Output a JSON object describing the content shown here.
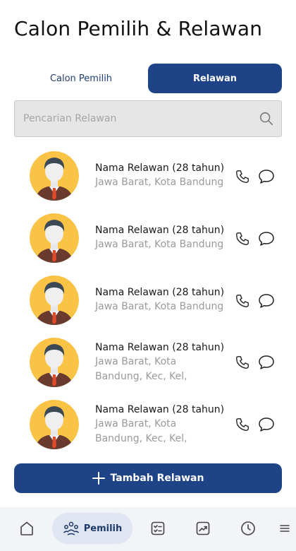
{
  "page": {
    "title": "Calon Pemilih & Relawan"
  },
  "tabs": [
    {
      "label": "Calon Pemilih",
      "active": false
    },
    {
      "label": "Relawan",
      "active": true
    }
  ],
  "search": {
    "placeholder": "Pencarian Relawan",
    "value": ""
  },
  "volunteers": [
    {
      "name": "Nama Relawan (28 tahun)",
      "location": "Jawa Barat, Kota Bandung"
    },
    {
      "name": "Nama Relawan (28 tahun)",
      "location": "Jawa Barat, Kota Bandung"
    },
    {
      "name": "Nama Relawan (28 tahun)",
      "location": "Jawa Barat, Kota Bandung"
    },
    {
      "name": "Nama Relawan (28 tahun)",
      "location": "Jawa Barat, Kota Bandung, Kec, Kel,"
    },
    {
      "name": "Nama Relawan (28 tahun)",
      "location": "Jawa Barat, Kota Bandung, Kec, Kel,"
    }
  ],
  "add_button": {
    "label": "Tambah Relawan"
  },
  "bottom_nav": [
    {
      "icon": "home-icon",
      "label": ""
    },
    {
      "icon": "people-icon",
      "label": "Pemilih",
      "active": true
    },
    {
      "icon": "checklist-icon",
      "label": ""
    },
    {
      "icon": "chart-icon",
      "label": ""
    },
    {
      "icon": "clock-icon",
      "label": ""
    },
    {
      "icon": "menu-icon",
      "label": ""
    }
  ],
  "colors": {
    "primary": "#1e4487",
    "avatar_bg": "#f9c345",
    "muted_text": "#9a9a9a",
    "nav_bg": "#f2f4f8",
    "nav_active_bg": "#dfe5f1"
  }
}
